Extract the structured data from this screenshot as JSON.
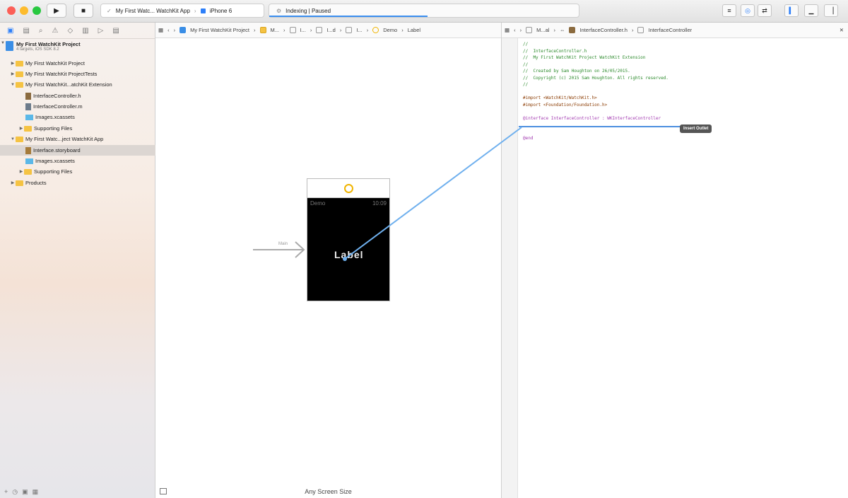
{
  "toolbar": {
    "scheme_target": "My First Watc... WatchKit App",
    "scheme_device": "iPhone 6",
    "activity_text": "Indexing | Paused"
  },
  "navigator": {
    "project_name": "My First WatchKit Project",
    "project_subtitle": "4 targets, iOS SDK 8.2",
    "items": [
      {
        "label": "My First WatchKit Project"
      },
      {
        "label": "My First WatchKit ProjectTests"
      },
      {
        "label": "My First WatchKit...atchKit Extension"
      },
      {
        "label": "InterfaceController.h"
      },
      {
        "label": "InterfaceController.m"
      },
      {
        "label": "Images.xcassets"
      },
      {
        "label": "Supporting Files"
      },
      {
        "label": "My First Watc...ject WatchKit App"
      },
      {
        "label": "Interface.storyboard"
      },
      {
        "label": "Images.xcassets"
      },
      {
        "label": "Supporting Files"
      },
      {
        "label": "Products"
      }
    ]
  },
  "canvas": {
    "breadcrumb": [
      "My First WatchKit Project",
      "M...",
      "I...",
      "I...d",
      "I...",
      "Demo",
      "Label"
    ],
    "watch_left": "Demo",
    "watch_right": "10:09",
    "watch_label": "Label",
    "entry_label": "Main",
    "size_class": "Any Screen Size"
  },
  "editor": {
    "breadcrumb": [
      "M...al",
      "InterfaceController.h",
      "InterfaceController"
    ],
    "code_lines": [
      {
        "cls": "c-comment",
        "text": "//"
      },
      {
        "cls": "c-comment",
        "text": "//  InterfaceController.h"
      },
      {
        "cls": "c-comment",
        "text": "//  My First WatchKit Project WatchKit Extension"
      },
      {
        "cls": "c-comment",
        "text": "//"
      },
      {
        "cls": "c-comment",
        "text": "//  Created by Sam Houghton on 26/05/2015."
      },
      {
        "cls": "c-comment",
        "text": "//  Copyright (c) 2015 Sam Houghton. All rights reserved."
      },
      {
        "cls": "c-comment",
        "text": "//"
      },
      {
        "cls": "",
        "text": ""
      },
      {
        "cls": "c-import",
        "text": "#import <WatchKit/WatchKit.h>"
      },
      {
        "cls": "c-import",
        "text": "#import <Foundation/Foundation.h>"
      },
      {
        "cls": "",
        "text": ""
      },
      {
        "cls": "c-kw",
        "text": "@interface InterfaceController : WKInterfaceController"
      },
      {
        "cls": "",
        "text": ""
      },
      {
        "cls": "",
        "text": ""
      },
      {
        "cls": "c-kw",
        "text": "@end"
      }
    ],
    "tooltip": "Insert Outlet"
  }
}
